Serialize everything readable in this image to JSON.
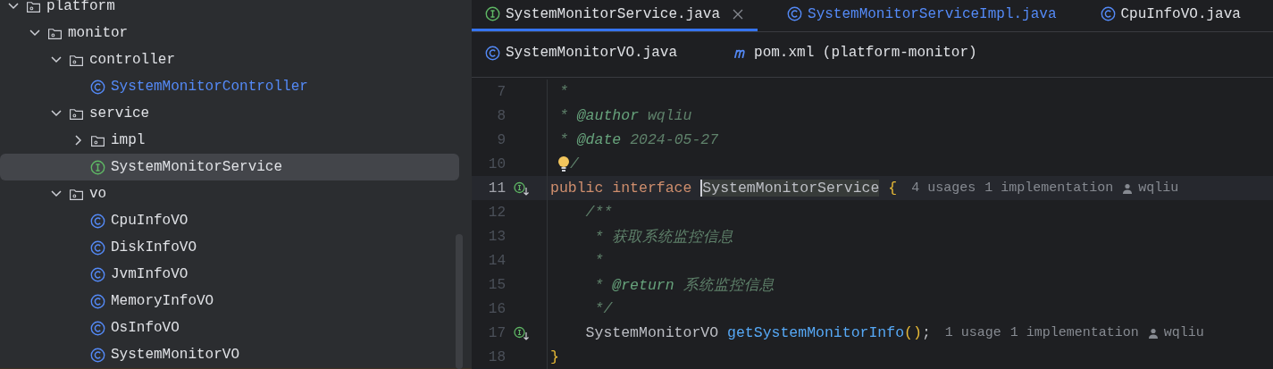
{
  "project_tree": {
    "items": [
      {
        "label": "platform",
        "kind": "folder",
        "expanded": true,
        "selected": false,
        "modified": false,
        "children": [
          {
            "label": "monitor",
            "kind": "folder",
            "expanded": true,
            "selected": false,
            "modified": false,
            "children": [
              {
                "label": "controller",
                "kind": "folder",
                "expanded": true,
                "selected": false,
                "modified": false,
                "children": [
                  {
                    "label": "SystemMonitorController",
                    "kind": "class",
                    "selected": false,
                    "modified": true
                  }
                ]
              },
              {
                "label": "service",
                "kind": "folder",
                "expanded": true,
                "selected": false,
                "modified": false,
                "children": [
                  {
                    "label": "impl",
                    "kind": "folder",
                    "expanded": false,
                    "selected": false,
                    "modified": false
                  },
                  {
                    "label": "SystemMonitorService",
                    "kind": "interface",
                    "selected": true,
                    "modified": false
                  }
                ]
              },
              {
                "label": "vo",
                "kind": "folder",
                "expanded": true,
                "selected": false,
                "modified": false,
                "children": [
                  {
                    "label": "CpuInfoVO",
                    "kind": "class",
                    "selected": false,
                    "modified": false
                  },
                  {
                    "label": "DiskInfoVO",
                    "kind": "class",
                    "selected": false,
                    "modified": false
                  },
                  {
                    "label": "JvmInfoVO",
                    "kind": "class",
                    "selected": false,
                    "modified": false
                  },
                  {
                    "label": "MemoryInfoVO",
                    "kind": "class",
                    "selected": false,
                    "modified": false
                  },
                  {
                    "label": "OsInfoVO",
                    "kind": "class",
                    "selected": false,
                    "modified": false
                  },
                  {
                    "label": "SystemMonitorVO",
                    "kind": "class",
                    "selected": false,
                    "modified": false
                  }
                ]
              }
            ]
          }
        ]
      }
    ]
  },
  "editor_tabs": [
    [
      {
        "label": "SystemMonitorService.java",
        "kind": "interface",
        "selected": true,
        "modified": false,
        "closable": true
      },
      {
        "label": "SystemMonitorServiceImpl.java",
        "kind": "class",
        "selected": false,
        "modified": true,
        "closable": false
      },
      {
        "label": "CpuInfoVO.java",
        "kind": "class",
        "selected": false,
        "modified": false,
        "closable": false
      }
    ],
    [
      {
        "label": "SystemMonitorVO.java",
        "kind": "class",
        "selected": false,
        "modified": false,
        "closable": false
      },
      {
        "label": "pom.xml (platform-monitor)",
        "kind": "maven",
        "selected": false,
        "modified": false,
        "closable": false
      }
    ]
  ],
  "code": {
    "lines": [
      {
        "number": "7",
        "current": false,
        "bulb": false,
        "marker": false,
        "tokens": [
          {
            "kind": "comment",
            "text": " *"
          }
        ]
      },
      {
        "number": "8",
        "current": false,
        "bulb": false,
        "marker": false,
        "tokens": [
          {
            "kind": "comment",
            "text": " * "
          },
          {
            "kind": "doctag",
            "text": "@author"
          },
          {
            "kind": "comment",
            "text": " wqliu"
          }
        ]
      },
      {
        "number": "9",
        "current": false,
        "bulb": false,
        "marker": false,
        "tokens": [
          {
            "kind": "comment",
            "text": " * "
          },
          {
            "kind": "doctag",
            "text": "@date"
          },
          {
            "kind": "comment",
            "text": " 2024-05-27"
          }
        ]
      },
      {
        "number": "10",
        "current": false,
        "bulb": true,
        "marker": false,
        "tokens": [
          {
            "kind": "comment",
            "text": "/"
          }
        ]
      },
      {
        "number": "11",
        "current": true,
        "bulb": false,
        "marker": true,
        "tokens": [
          {
            "kind": "keyword",
            "text": "public interface "
          },
          {
            "kind": "caret-word",
            "text": "SystemMonitorService"
          },
          {
            "kind": "brace",
            "text": " {"
          }
        ],
        "hints": [
          {
            "kind": "text",
            "text": "4 usages"
          },
          {
            "kind": "text",
            "text": "1 implementation"
          },
          {
            "kind": "author",
            "text": "wqliu"
          }
        ]
      },
      {
        "number": "12",
        "current": false,
        "bulb": false,
        "marker": false,
        "tokens": [
          {
            "kind": "comment",
            "text": "    /**"
          }
        ]
      },
      {
        "number": "13",
        "current": false,
        "bulb": false,
        "marker": false,
        "tokens": [
          {
            "kind": "comment",
            "text": "     * 获取系统监控信息"
          }
        ]
      },
      {
        "number": "14",
        "current": false,
        "bulb": false,
        "marker": false,
        "tokens": [
          {
            "kind": "comment",
            "text": "     *"
          }
        ]
      },
      {
        "number": "15",
        "current": false,
        "bulb": false,
        "marker": false,
        "tokens": [
          {
            "kind": "comment",
            "text": "     * "
          },
          {
            "kind": "doctag",
            "text": "@return"
          },
          {
            "kind": "comment",
            "text": " 系统监控信息"
          }
        ]
      },
      {
        "number": "16",
        "current": false,
        "bulb": false,
        "marker": false,
        "tokens": [
          {
            "kind": "comment",
            "text": "     */"
          }
        ]
      },
      {
        "number": "17",
        "current": false,
        "bulb": false,
        "marker": true,
        "tokens": [
          {
            "kind": "plain",
            "text": "    SystemMonitorVO "
          },
          {
            "kind": "method",
            "text": "getSystemMonitorInfo"
          },
          {
            "kind": "brace",
            "text": "()"
          },
          {
            "kind": "plain",
            "text": ";"
          }
        ],
        "hints": [
          {
            "kind": "text",
            "text": "1 usage"
          },
          {
            "kind": "text",
            "text": "1 implementation"
          },
          {
            "kind": "author",
            "text": "wqliu"
          }
        ]
      },
      {
        "number": "18",
        "current": false,
        "bulb": false,
        "marker": false,
        "tokens": [
          {
            "kind": "brace",
            "text": "}"
          }
        ]
      }
    ]
  }
}
